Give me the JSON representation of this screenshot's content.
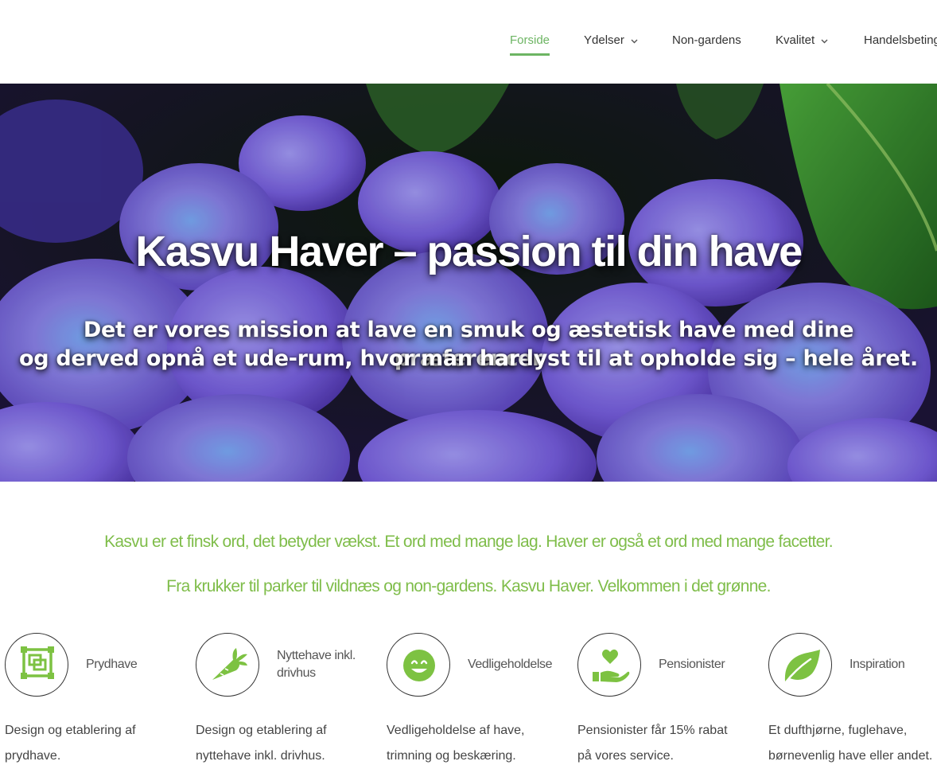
{
  "nav": {
    "items": [
      {
        "label": "Forside",
        "active": true
      },
      {
        "label": "Ydelser",
        "dropdown": true
      },
      {
        "label": "Non-gardens"
      },
      {
        "label": "Kvalitet",
        "dropdown": true
      },
      {
        "label": "Handelsbetingelser"
      }
    ]
  },
  "hero": {
    "title": "Kasvu Haver – passion til din have",
    "subtitle_line1": "Det er vores mission at lave en smuk og æstetisk have med dine præferencer",
    "subtitle_line2": "og derved opnå et ude-rum, hvor man har lyst til at opholde sig – hele året."
  },
  "intro": {
    "line1": "Kasvu er et finsk ord, det betyder vækst. Et ord med mange lag. Haver er også et ord med mange facetter.",
    "line2": "Fra krukker til parker til vildnæs og non-gardens. Kasvu Haver. Velkommen i det grønne."
  },
  "features": [
    {
      "icon": "garden-design-icon",
      "label": "Prydhave",
      "desc_line1": "Design og etablering af",
      "desc_line2": "prydhave."
    },
    {
      "icon": "carrot-icon",
      "label_line1": "Nyttehave inkl.",
      "label_line2": "drivhus",
      "desc_line1": "Design og etablering af",
      "desc_line2": "nyttehave inkl. drivhus."
    },
    {
      "icon": "smiley-icon",
      "label": "Vedligeholdelse",
      "desc_line1": "Vedligeholdelse af have,",
      "desc_line2": "trimning og beskæring."
    },
    {
      "icon": "heart-hand-icon",
      "label": "Pensionister",
      "desc_line1": "Pensionister får 15% rabat",
      "desc_line2": "på vores service."
    },
    {
      "icon": "leaf-icon",
      "label": "Inspiration",
      "desc_line1": "Et dufthjørne, fuglehave,",
      "desc_line2": "børnevenlig have eller andet."
    }
  ],
  "colors": {
    "accent_green": "#6db563",
    "icon_green": "#7dc242",
    "intro_green": "#7fbd4a"
  }
}
